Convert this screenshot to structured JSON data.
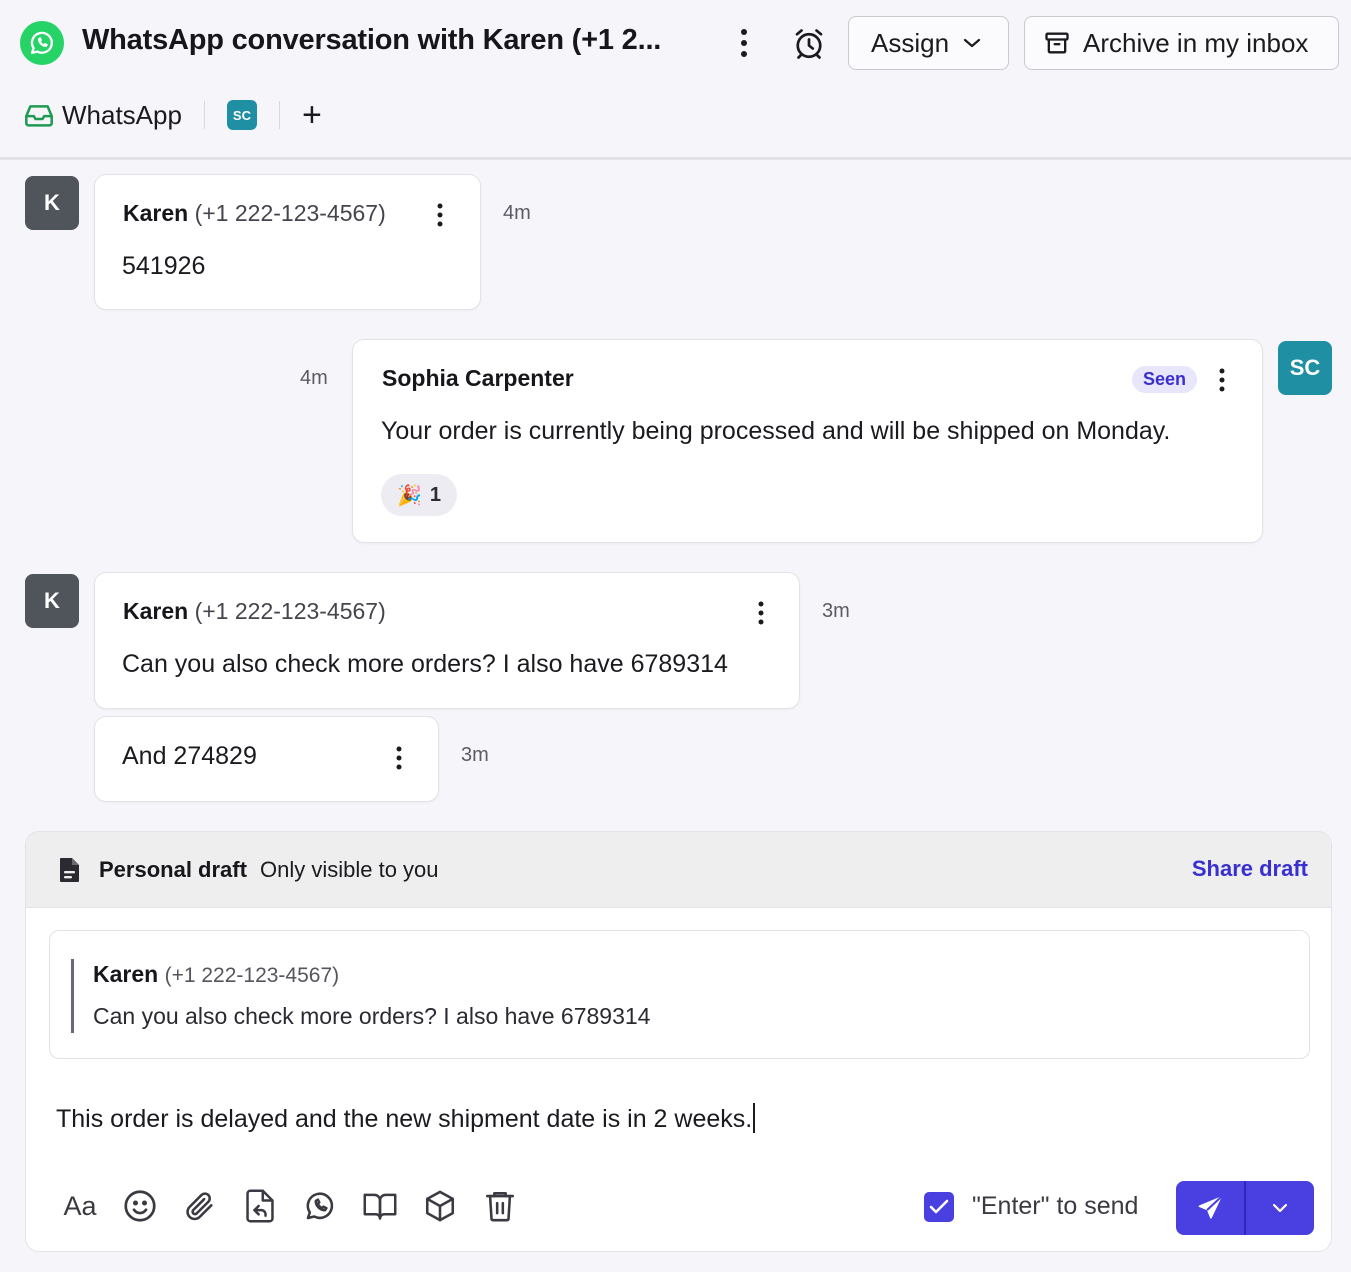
{
  "header": {
    "title": "WhatsApp conversation with Karen (+1 2...",
    "assign_label": "Assign",
    "archive_label": "Archive in my inbox"
  },
  "channels": {
    "inbox_label": "WhatsApp",
    "assignee_initials": "SC",
    "add_symbol": "+"
  },
  "messages": [
    {
      "avatar": "K",
      "sender": "Karen",
      "phone": "(+1 222-123-4567)",
      "text": "541926",
      "time": "4m"
    },
    {
      "avatar": "SC",
      "sender": "Sophia Carpenter",
      "status": "Seen",
      "text": "Your order is currently being processed and will be shipped on Monday.",
      "time": "4m",
      "reaction": {
        "emoji": "🎉",
        "count": "1"
      }
    },
    {
      "avatar": "K",
      "sender": "Karen",
      "phone": "(+1 222-123-4567)",
      "text": "Can you also check more orders? I also have 6789314",
      "time": "3m"
    },
    {
      "text": "And 274829",
      "time": "3m"
    }
  ],
  "draft": {
    "title": "Personal draft",
    "subtitle": "Only visible to you",
    "share_label": "Share draft",
    "quote": {
      "sender": "Karen",
      "phone": "(+1 222-123-4567)",
      "text": "Can you also check more orders? I also have 6789314"
    },
    "body": "This order is delayed and the new shipment date is in 2 weeks.",
    "format_label": "Aa",
    "enter_to_send_label": "\"Enter\" to send",
    "enter_to_send_checked": true
  },
  "colors": {
    "accent": "#4a3fe0",
    "whatsapp_green": "#25d366",
    "avatar_teal": "#1f8fa3",
    "avatar_gray": "#50545b"
  }
}
